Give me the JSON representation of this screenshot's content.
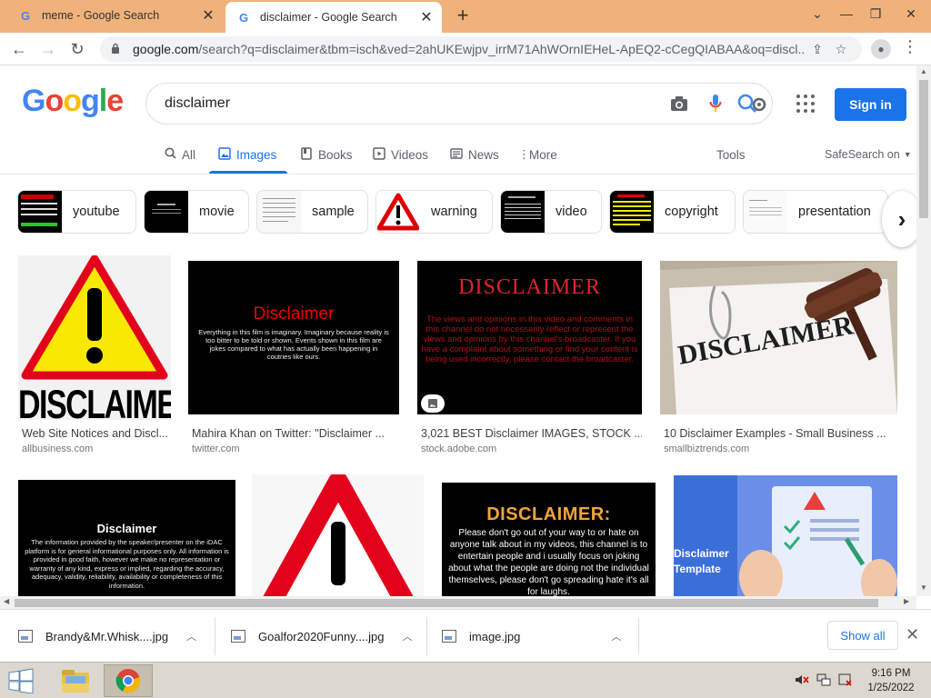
{
  "browser": {
    "tabs": [
      {
        "title": "meme - Google Search"
      },
      {
        "title": "disclaimer - Google Search"
      }
    ],
    "url_host": "google.com",
    "url_path": "/search?q=disclaimer&tbm=isch&ved=2ahUKEwjpv_irrM71AhWOrnIEHeL-ApEQ2-cCegQIABAA&oq=discl..."
  },
  "google": {
    "logo": [
      "G",
      "o",
      "o",
      "g",
      "l",
      "e"
    ],
    "logo_colors": [
      "#4285f4",
      "#ea4335",
      "#fbbc05",
      "#4285f4",
      "#34a853",
      "#ea4335"
    ],
    "query": "disclaimer",
    "signin_label": "Sign in",
    "tabs": [
      {
        "label": "All",
        "icon": "search-icon"
      },
      {
        "label": "Images",
        "icon": "image-icon"
      },
      {
        "label": "Books",
        "icon": "book-icon"
      },
      {
        "label": "Videos",
        "icon": "video-icon"
      },
      {
        "label": "News",
        "icon": "news-icon"
      },
      {
        "label": "More",
        "icon": "more-vert-icon"
      }
    ],
    "tools_label": "Tools",
    "safesearch_label": "SafeSearch on"
  },
  "chips": [
    {
      "label": "youtube"
    },
    {
      "label": "movie"
    },
    {
      "label": "sample"
    },
    {
      "label": "warning"
    },
    {
      "label": "video"
    },
    {
      "label": "copyright"
    },
    {
      "label": "presentation"
    }
  ],
  "results": [
    {
      "caption": "Web Site Notices and Discl...",
      "source": "allbusiness.com",
      "img_text": "DISCLAIMER"
    },
    {
      "caption": "Mahira Khan on Twitter: \"Disclaimer ...",
      "source": "twitter.com",
      "img_title": "Disclaimer",
      "img_text": "Everything in this film is imaginary. Imaginary because reality is too bitter to be told or shown. Events shown in this film are jokes compared to what has actually been happening in coutries like ours."
    },
    {
      "caption": "3,021 BEST Disclaimer IMAGES, STOCK ...",
      "source": "stock.adobe.com",
      "img_title": "DISCLAIMER",
      "img_text": "The views and opinions in this video and comments in this channel do not necessarily reflect or represent the views and opinions by this channel's broadcaster. If you have a complaint about something or find your content is being used incorrectly, please contact the broadcaster."
    },
    {
      "caption": "10 Disclaimer Examples - Small Business ...",
      "source": "smallbiztrends.com",
      "img_text": "DISCLAIMER"
    },
    {
      "img_title": "Disclaimer",
      "img_text": "The information provided by the speaker/presenter on the iDAC platform is for general informational purposes only. All information is provided in good faith, however we make no representation or warranty of any kind, express or implied, regarding the accuracy, adequacy, validity, reliability, availability or completeness of this information."
    },
    {
      "img_text": ""
    },
    {
      "img_title": "DISCLAIMER:",
      "img_text": "Please don't go out of your way to or hate on anyone talk about in my videos, this channel is to entertain people and i usually focus on joking about what the people are doing not the individual themselves, please don't go spreading hate it's all for laughs."
    },
    {
      "img_title": "Disclaimer Template"
    }
  ],
  "downloads": [
    {
      "name": "Brandy&Mr.Whisk....jpg"
    },
    {
      "name": "Goalfor2020Funny....jpg"
    },
    {
      "name": "image.jpg"
    }
  ],
  "show_all_label": "Show all",
  "taskbar": {
    "time": "9:16 PM",
    "date": "1/25/2022"
  }
}
